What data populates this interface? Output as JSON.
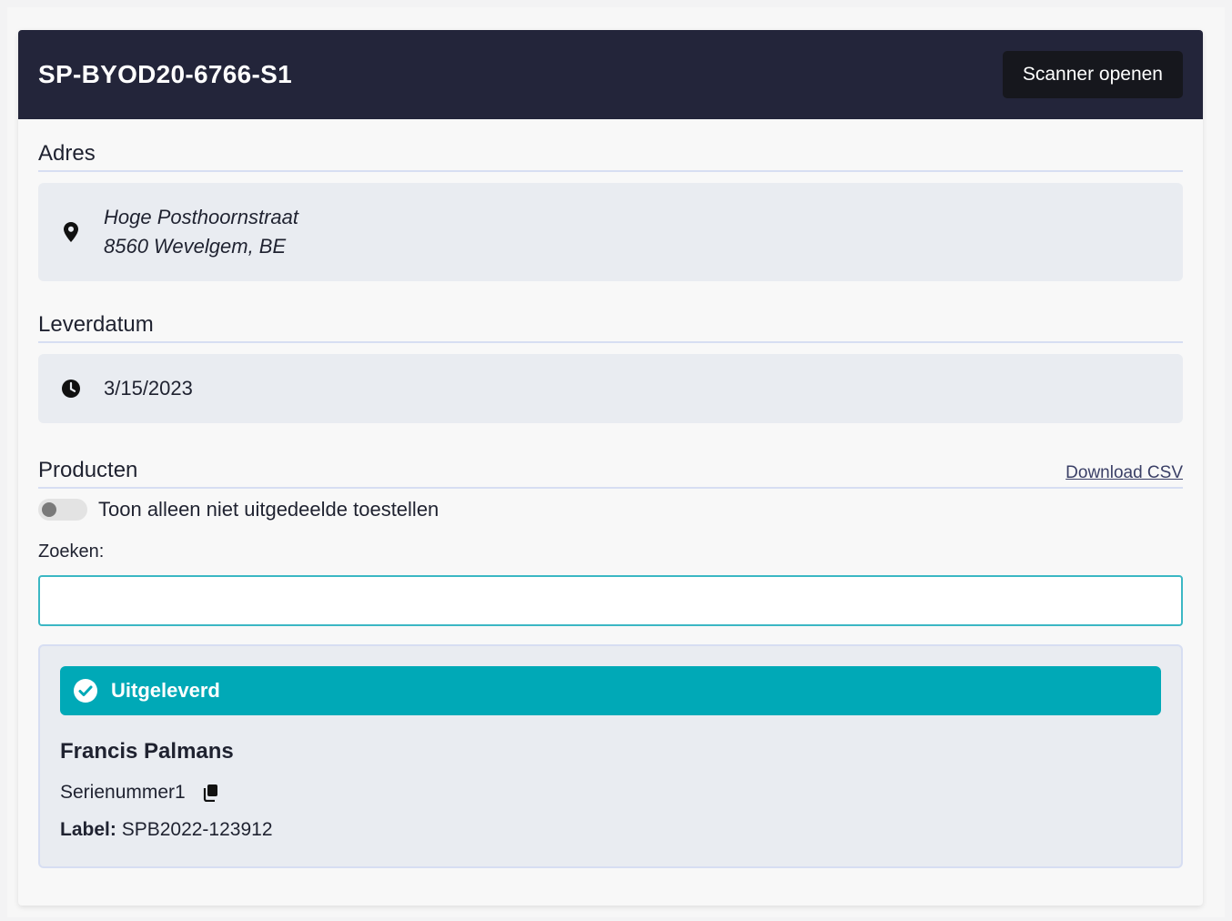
{
  "header": {
    "title": "SP-BYOD20-6766-S1",
    "scanner_button": "Scanner openen"
  },
  "address_section": {
    "title": "Adres",
    "icon": "map-pin-icon",
    "line1": "Hoge Posthoornstraat",
    "line2": "8560 Wevelgem, BE"
  },
  "delivery_section": {
    "title": "Leverdatum",
    "icon": "clock-icon",
    "date": "3/15/2023"
  },
  "products_section": {
    "title": "Producten",
    "download_link": "Download CSV",
    "toggle_label": "Toon alleen niet uitgedeelde toestellen",
    "toggle_on": false,
    "search_label": "Zoeken:",
    "search_value": "",
    "items": [
      {
        "status": "Uitgeleverd",
        "status_icon": "check-circle-icon",
        "name": "Francis Palmans",
        "serial": "Serienummer1",
        "label_key": "Label:",
        "label_value": "SPB2022-123912"
      }
    ]
  },
  "colors": {
    "header_bg": "#23253a",
    "status_bg": "#00a9b7",
    "input_border": "#3bb7c4"
  }
}
